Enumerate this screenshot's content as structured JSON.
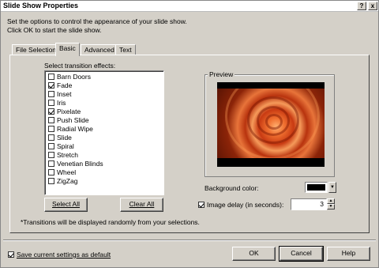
{
  "window": {
    "title": "Slide Show Properties",
    "help_glyph": "?",
    "close_glyph": "x"
  },
  "intro": {
    "line1": "Set the options to control the appearance of your slide show.",
    "line2": "Click OK to start the slide show."
  },
  "tabs": [
    {
      "label": "File Selection",
      "active": false
    },
    {
      "label": "Basic",
      "active": true
    },
    {
      "label": "Advanced",
      "active": false
    },
    {
      "label": "Text",
      "active": false
    }
  ],
  "transitions": {
    "label": "Select transition effects:",
    "items": [
      {
        "label": "Barn Doors",
        "checked": false
      },
      {
        "label": "Fade",
        "checked": true
      },
      {
        "label": "Inset",
        "checked": false
      },
      {
        "label": "Iris",
        "checked": false
      },
      {
        "label": "Pixelate",
        "checked": true
      },
      {
        "label": "Push Slide",
        "checked": false
      },
      {
        "label": "Radial Wipe",
        "checked": false
      },
      {
        "label": "Slide",
        "checked": false
      },
      {
        "label": "Spiral",
        "checked": false
      },
      {
        "label": "Stretch",
        "checked": false
      },
      {
        "label": "Venetian Blinds",
        "checked": false
      },
      {
        "label": "Wheel",
        "checked": false
      },
      {
        "label": "ZigZag",
        "checked": false
      }
    ],
    "select_all": "Select All",
    "clear_all": "Clear All",
    "note": "*Transitions will be displayed randomly from your selections."
  },
  "preview": {
    "label": "Preview"
  },
  "background": {
    "label": "Background color:",
    "color": "#000000"
  },
  "image_delay": {
    "label": "Image delay (in seconds):",
    "checked": true,
    "value": "3"
  },
  "footer": {
    "save_default_label": "Save current settings as default",
    "save_default_checked": true,
    "ok": "OK",
    "cancel": "Cancel",
    "help": "Help"
  }
}
